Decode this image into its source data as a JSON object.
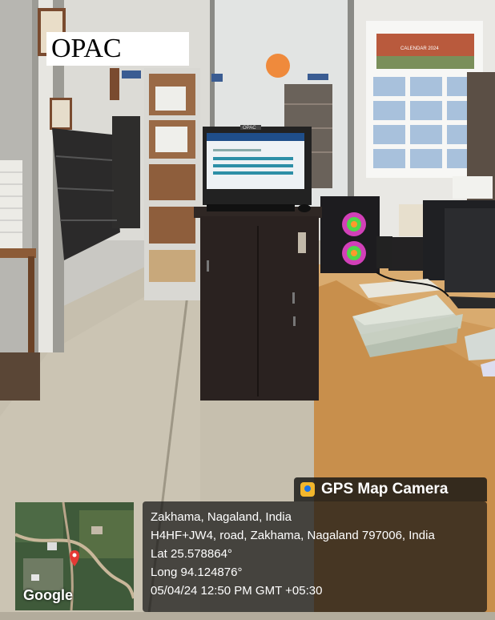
{
  "overlay_label": "OPAC",
  "gps": {
    "app_name": "GPS Map Camera",
    "place": "Zakhama, Nagaland, India",
    "address": "H4HF+JW4, road, Zakhama, Nagaland 797006, India",
    "lat": "Lat 25.578864°",
    "long": "Long 94.124876°",
    "datetime": "05/04/24 12:50 PM GMT +05:30",
    "map_credit": "Google"
  },
  "screen_text": "OPAC",
  "poster_title": "CALENDAR 2024"
}
